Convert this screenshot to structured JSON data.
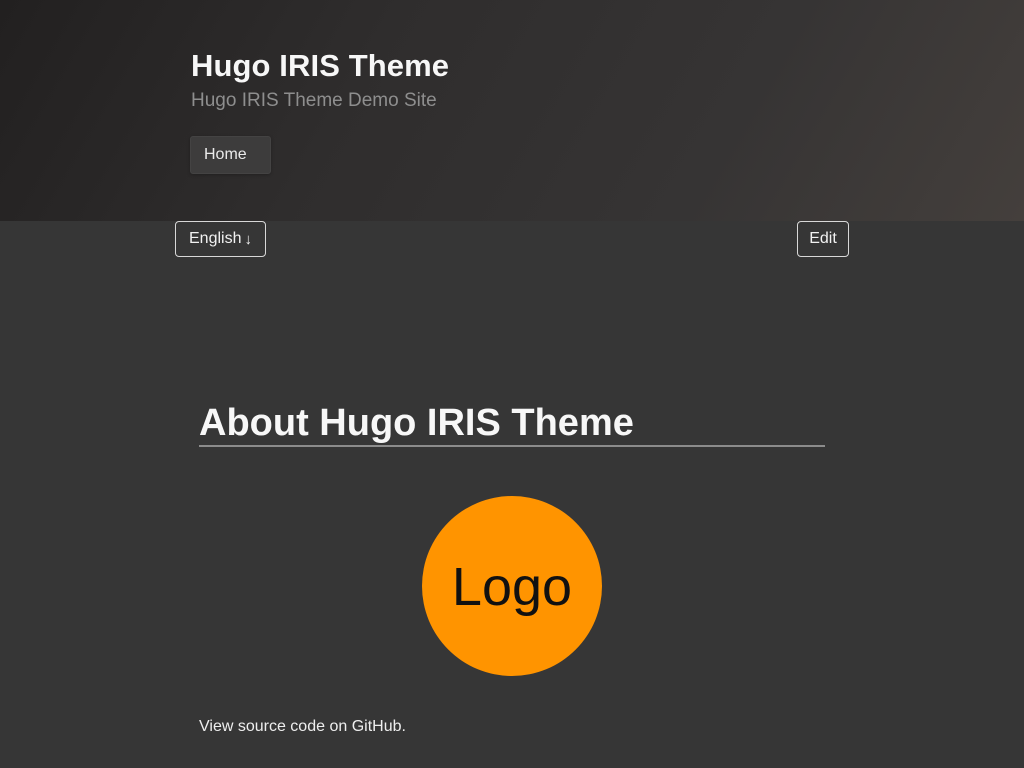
{
  "header": {
    "title": "Hugo IRIS Theme",
    "subtitle": "Hugo IRIS Theme Demo Site",
    "nav": {
      "home_label": "Home"
    }
  },
  "toolbar": {
    "language_label": "English",
    "language_arrow": "↓",
    "edit_label": "Edit"
  },
  "main": {
    "title": "About Hugo IRIS Theme",
    "logo_text": "Logo",
    "logo_color": "#ff9400",
    "source_prefix": "View source code on ",
    "source_link": "GitHub",
    "source_suffix": "."
  }
}
